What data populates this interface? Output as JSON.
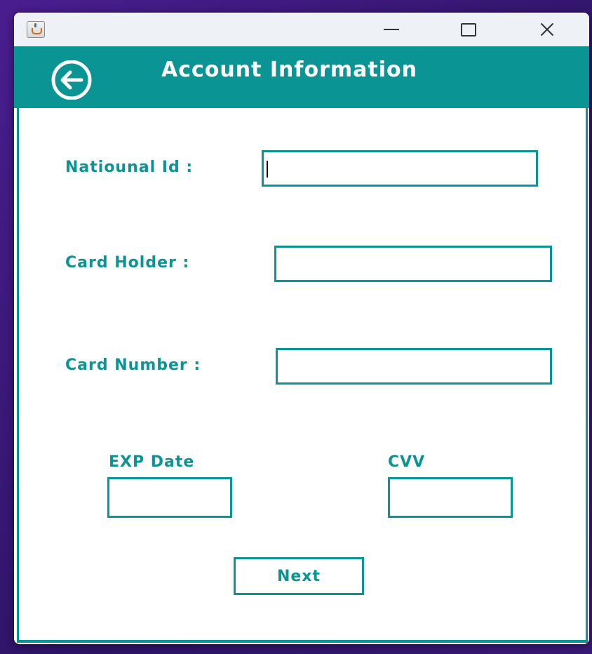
{
  "window": {
    "controls": {
      "minimize_icon": "minimize-icon",
      "maximize_icon": "maximize-icon",
      "close_icon": "close-icon"
    },
    "app_icon": "java-cup-icon"
  },
  "header": {
    "title": "Account Information",
    "back_icon": "back-arrow-circle-icon",
    "background_color": "#0b9494"
  },
  "form": {
    "national_id": {
      "label": "Natiounal Id :",
      "value": ""
    },
    "card_holder": {
      "label": "Card Holder :",
      "value": ""
    },
    "card_number": {
      "label": "Card Number :",
      "value": ""
    },
    "exp_date": {
      "label": "EXP Date",
      "value": ""
    },
    "cvv": {
      "label": "CVV",
      "value": ""
    },
    "next_label": "Next"
  },
  "colors": {
    "accent": "#0b9494",
    "text_accent": "#0b9494",
    "background": "#ffffff"
  }
}
